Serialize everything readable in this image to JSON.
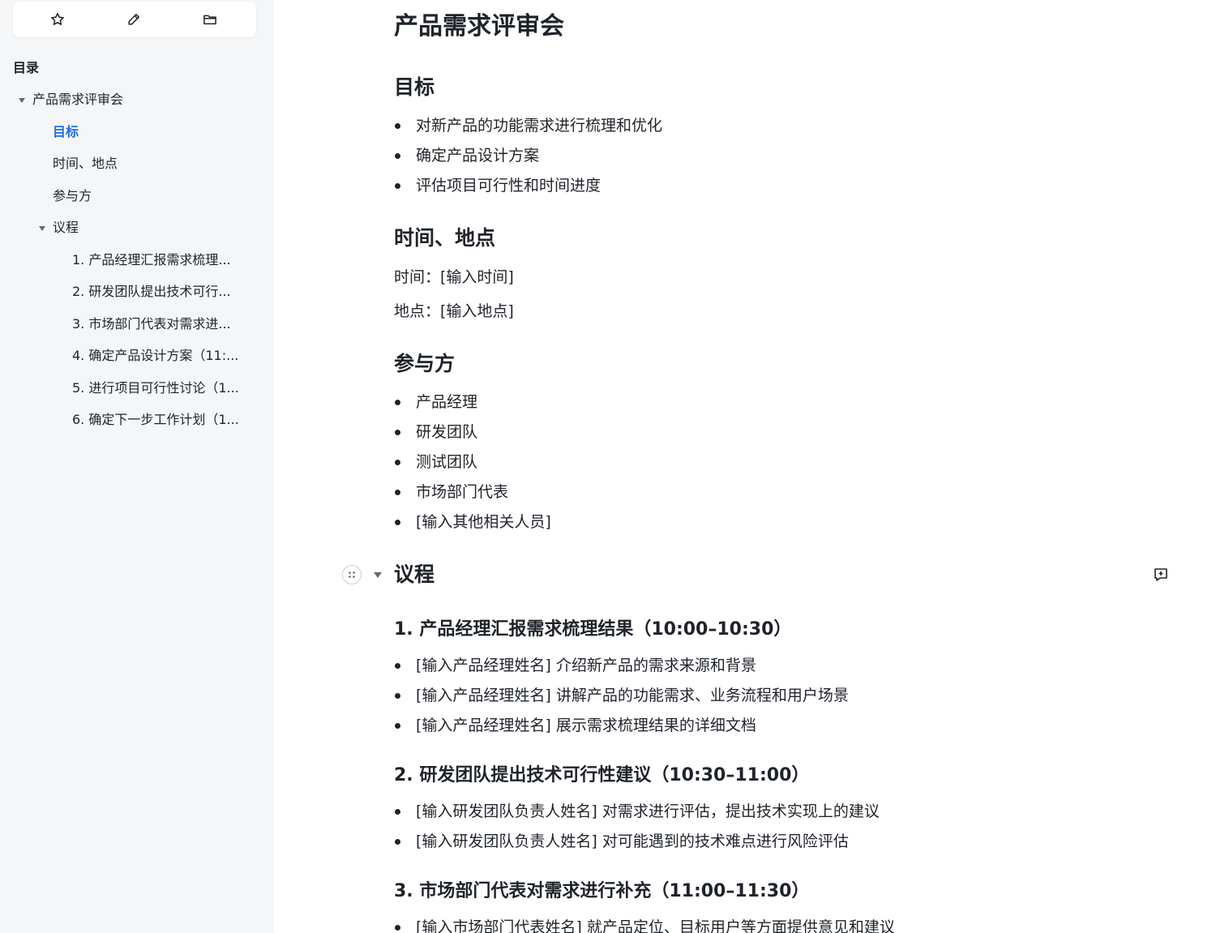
{
  "toolbar": {
    "icons": [
      "star-icon",
      "edit-icon",
      "folder-icon"
    ]
  },
  "toc": {
    "title": "目录",
    "items": [
      {
        "label": "产品需求评审会"
      },
      {
        "label": "目标"
      },
      {
        "label": "时间、地点"
      },
      {
        "label": "参与方"
      },
      {
        "label": "议程"
      },
      {
        "label": "1. 产品经理汇报需求梳理..."
      },
      {
        "label": "2. 研发团队提出技术可行..."
      },
      {
        "label": "3. 市场部门代表对需求进..."
      },
      {
        "label": "4. 确定产品设计方案（11:..."
      },
      {
        "label": "5. 进行项目可行性讨论（1..."
      },
      {
        "label": "6. 确定下一步工作计划（1..."
      }
    ],
    "active_label": "目标"
  },
  "doc": {
    "title": "产品需求评审会",
    "goal": {
      "heading": "目标",
      "items": [
        "对新产品的功能需求进行梳理和优化",
        "确定产品设计方案",
        "评估项目可行性和时间进度"
      ]
    },
    "time_place": {
      "heading": "时间、地点",
      "time": "时间：[输入时间]",
      "place": "地点：[输入地点]"
    },
    "participants": {
      "heading": "参与方",
      "items": [
        "产品经理",
        "研发团队",
        "测试团队",
        "市场部门代表",
        "[输入其他相关人员]"
      ]
    },
    "agenda": {
      "heading": "议程",
      "sections": [
        {
          "title": "1. 产品经理汇报需求梳理结果（10:00–10:30）",
          "items": [
            "[输入产品经理姓名] 介绍新产品的需求来源和背景",
            "[输入产品经理姓名] 讲解产品的功能需求、业务流程和用户场景",
            "[输入产品经理姓名] 展示需求梳理结果的详细文档"
          ]
        },
        {
          "title": "2. 研发团队提出技术可行性建议（10:30–11:00）",
          "items": [
            "[输入研发团队负责人姓名] 对需求进行评估，提出技术实现上的建议",
            "[输入研发团队负责人姓名] 对可能遇到的技术难点进行风险评估"
          ]
        },
        {
          "title": "3. 市场部门代表对需求进行补充（11:00–11:30）",
          "items": [
            "[输入市场部门代表姓名] 就产品定位、目标用户等方面提供意见和建议"
          ]
        }
      ]
    }
  }
}
